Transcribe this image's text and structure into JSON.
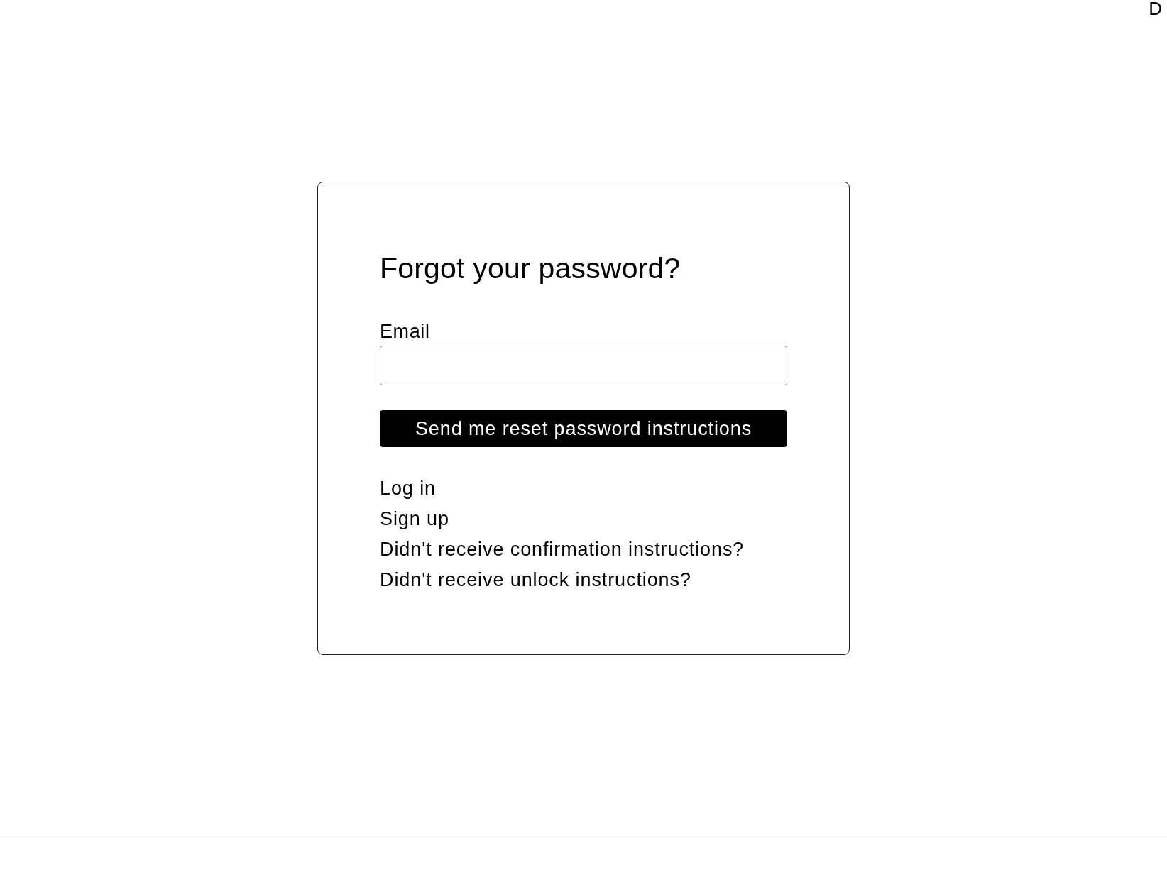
{
  "header": {
    "text": "D"
  },
  "form": {
    "title": "Forgot your password?",
    "field": {
      "label": "Email"
    },
    "submit_button": "Send me reset password instructions",
    "links": [
      "Log in",
      "Sign up",
      "Didn't receive confirmation instructions?",
      "Didn't receive unlock instructions?"
    ]
  }
}
